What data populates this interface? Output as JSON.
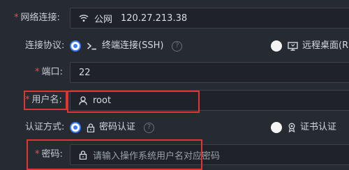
{
  "form": {
    "network": {
      "label": "网络连接:",
      "name": "公网",
      "ip": "120.27.213.38"
    },
    "protocol": {
      "label": "连接协议:",
      "option_ssh": "终端连接(SSH)",
      "option_rdp": "远程桌面(R",
      "selected": "ssh"
    },
    "port": {
      "label": "端口:",
      "value": "22"
    },
    "username": {
      "label": "用户名:",
      "value": "root"
    },
    "auth": {
      "label": "认证方式:",
      "option_password": "密码认证",
      "option_cert": "证书认证",
      "selected": "password"
    },
    "password": {
      "label": "密码:",
      "placeholder": "请输入操作系统用户名对应密码"
    }
  },
  "colors": {
    "background": "#262a31",
    "required": "#ef4b47",
    "accent": "#3d7bf5",
    "highlight": "#e03535"
  }
}
